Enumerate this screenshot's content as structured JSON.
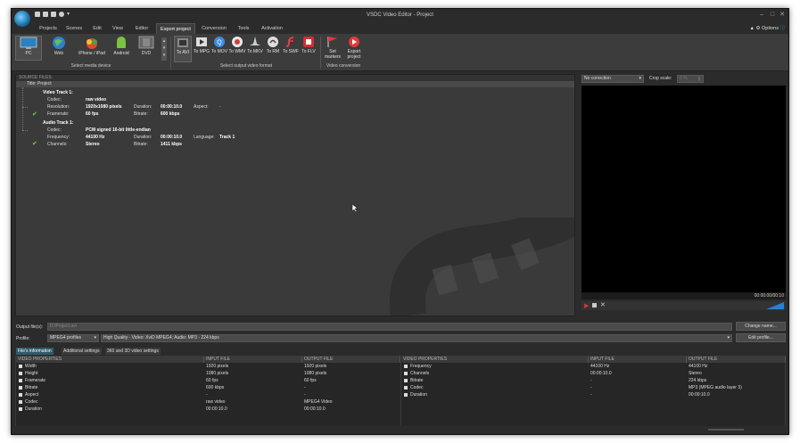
{
  "window": {
    "title": "VSDC Video Editor - Project"
  },
  "menu": {
    "tabs": [
      "Projects",
      "Scenes",
      "Edit",
      "View",
      "Editor",
      "Export project",
      "Conversion",
      "Tools",
      "Activation"
    ],
    "active": "Export project",
    "options_label": "Options"
  },
  "ribbon": {
    "media_devices": [
      {
        "label": "PC",
        "icon": "pc-icon"
      },
      {
        "label": "Web",
        "icon": "globe-icon"
      },
      {
        "label": "iPhone / iPad",
        "icon": "apple-icon"
      },
      {
        "label": "Android",
        "icon": "android-icon"
      },
      {
        "label": "DVD",
        "icon": "dvd-icon"
      }
    ],
    "media_group_label": "Select media device",
    "formats": [
      {
        "label": "To AVI",
        "icon": "avi-icon"
      },
      {
        "label": "To MPG",
        "icon": "mpg-icon"
      },
      {
        "label": "To MOV",
        "icon": "mov-icon"
      },
      {
        "label": "To WMV",
        "icon": "wmv-icon"
      },
      {
        "label": "To MKV",
        "icon": "mkv-icon"
      },
      {
        "label": "To RM",
        "icon": "rm-icon"
      },
      {
        "label": "To SWF",
        "icon": "swf-icon"
      },
      {
        "label": "To FLV",
        "icon": "flv-icon"
      }
    ],
    "format_group_label": "Select output video format",
    "conversion": [
      {
        "label": "Set markers",
        "icon": "flag-icon"
      },
      {
        "label": "Export project",
        "icon": "export-icon"
      }
    ],
    "conversion_group_label": "Video conversion"
  },
  "source": {
    "header": "SOURCE FILES",
    "title": "Title: Project",
    "video_track": {
      "name": "Video Track 1:",
      "codec_label": "Codec:",
      "codec": "raw video",
      "resolution_label": "Resolution:",
      "resolution": "1920x1080 pixels",
      "duration_label": "Duration:",
      "duration": "00:00:10.0",
      "aspect_label": "Aspect:",
      "aspect": "-",
      "framerate_label": "Framerate:",
      "framerate": "60 fps",
      "bitrate_label": "Bitrate:",
      "bitrate": "600 kbps"
    },
    "audio_track": {
      "name": "Audio Track 1:",
      "codec_label": "Codec:",
      "codec": "PCM signed 16-bit little-endian",
      "frequency_label": "Frequency:",
      "frequency": "44100 Hz",
      "duration_label": "Duration:",
      "duration": "00:00:10.0",
      "language_label": "Language:",
      "language": "Track 1",
      "channels_label": "Channels:",
      "channels": "Stereo",
      "bitrate_label": "Bitrate:",
      "bitrate": "1411 kbps"
    }
  },
  "preview": {
    "correction": "No correction",
    "crop_label": "Crop scale:",
    "crop_value": "0 %",
    "time": "00:00:00/00:10"
  },
  "output": {
    "label": "Output file(s):",
    "path": "D:\\Project.avi",
    "change_name": "Change name..."
  },
  "profile": {
    "label": "Profile:",
    "format": "MPEG4 profiles",
    "value": "High Quality - Video: XviD MPEG4; Audio: MP3 - 224 kbps",
    "edit": "Edit profile..."
  },
  "props_tabs": [
    "File's information",
    "Additional settings",
    "360 and 3D video settings"
  ],
  "video_props": {
    "headers": [
      "VIDEO PROPERTIES",
      "INPUT FILE",
      "OUTPUT FILE"
    ],
    "rows": [
      [
        "Width",
        "1920 pixels",
        "1920 pixels"
      ],
      [
        "Height",
        "1080 pixels",
        "1080 pixels"
      ],
      [
        "Framerate",
        "60 fps",
        "60 fps"
      ],
      [
        "Bitrate",
        "600 kbps",
        "-"
      ],
      [
        "Aspect",
        "-",
        "-"
      ],
      [
        "Codec",
        "raw video",
        "MPEG4 Video"
      ],
      [
        "Duration",
        "00:00:10.0",
        "00:00:10.0"
      ]
    ]
  },
  "audio_props": {
    "headers": [
      "VIDEO PROPERTIES",
      "INPUT FILE",
      "OUTPUT FILE"
    ],
    "rows": [
      [
        "Frequency",
        "44100 Hz",
        "44100 Hz"
      ],
      [
        "Channels",
        "00:00:10.0",
        "Stereo"
      ],
      [
        "Bitrate",
        "-",
        "224 kbps"
      ],
      [
        "Codec",
        "-",
        "MP3 (MPEG audio layer 3)"
      ],
      [
        "Duration",
        "-",
        "00:00:10.0"
      ]
    ]
  }
}
